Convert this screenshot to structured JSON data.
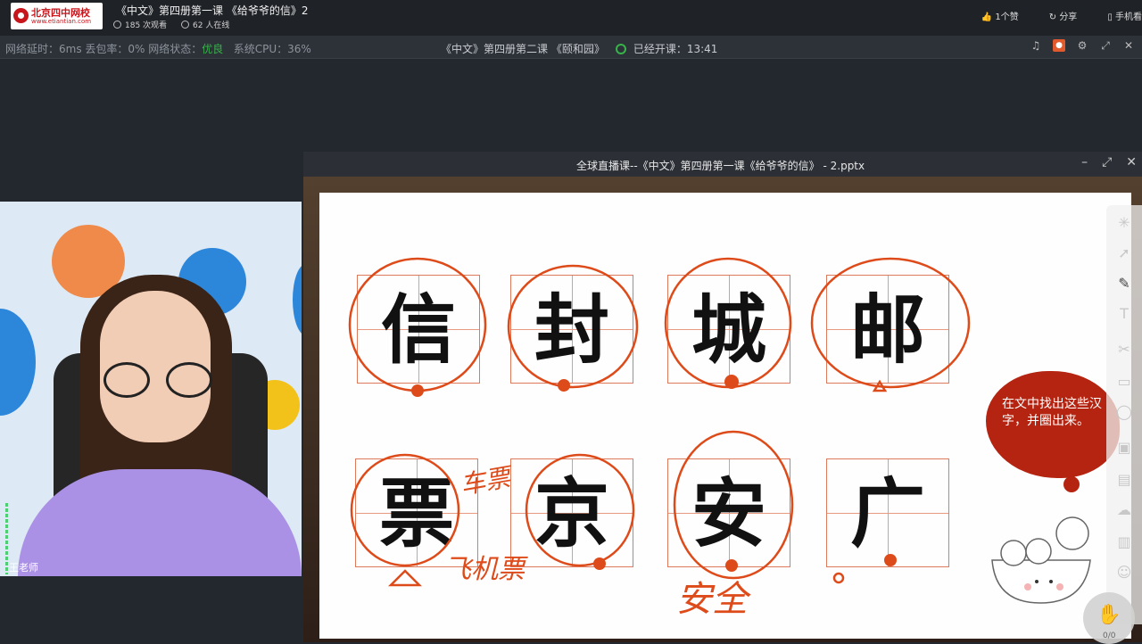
{
  "header": {
    "logo_cn": "北京四中网校",
    "logo_en": "www.etiantian.com",
    "course_title": "《中文》第四册第一课 《给爷爷的信》2",
    "views": "185 次观看",
    "online": "62 人在线",
    "likes": "1个赞",
    "share": "分享",
    "mobile": "手机看"
  },
  "status": {
    "latency_label": "网络延时：6ms 丢包率：0% 网络状态：",
    "network_state": "优良",
    "cpu": "系统CPU：36%",
    "lesson": "《中文》第四册第二课 《颐和园》",
    "elapsed": "已经开课：13:41"
  },
  "camera": {
    "teacher_name": "王老师"
  },
  "ppt": {
    "window_title": "全球直播课--《中文》第四册第一课《给爷爷的信》 - 2.pptx",
    "characters": [
      "信",
      "封",
      "城",
      "邮",
      "票",
      "京",
      "安",
      "广"
    ],
    "instruction": "在文中找出这些汉字，并圈出来。",
    "handwriting": [
      "车票",
      "飞机票",
      "安全"
    ]
  },
  "tools": [
    "laser-pointer-icon",
    "select-icon",
    "pen-icon",
    "text-icon",
    "scissors-icon",
    "eraser-icon",
    "shapes-icon",
    "image-icon",
    "chat-icon",
    "cloud-icon",
    "toolbox-icon",
    "users-icon"
  ],
  "raise_hand": {
    "count": "0/0"
  },
  "colors": {
    "accent": "#37b34a",
    "annotation": "#de4b1a",
    "cloud": "#b52410",
    "grid": "#de7a5c"
  }
}
